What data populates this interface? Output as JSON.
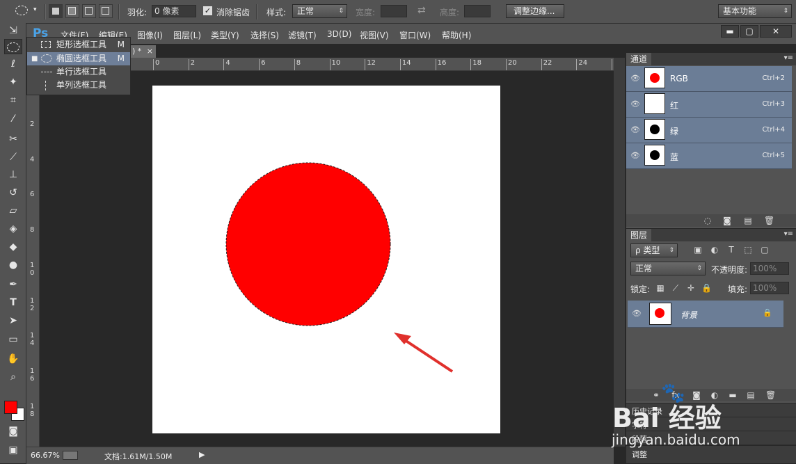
{
  "options_bar": {
    "feather_label": "羽化:",
    "feather_value": "0 像素",
    "antialias_label": "消除锯齿",
    "style_label": "样式:",
    "style_value": "正常",
    "width_label": "宽度:",
    "height_label": "高度:",
    "refine_edge_button": "调整边缘...",
    "workspace_value": "基本功能"
  },
  "menu_bar": {
    "logo": "Ps",
    "items": [
      "文件(F)",
      "编辑(E)",
      "图像(I)",
      "图层(L)",
      "类型(Y)",
      "选择(S)",
      "滤镜(T)",
      "3D(D)",
      "视图(V)",
      "窗口(W)",
      "帮助(H)"
    ]
  },
  "tool_flyout": {
    "items": [
      {
        "label": "矩形选框工具",
        "key": "M",
        "selected": false
      },
      {
        "label": "椭圆选框工具",
        "key": "M",
        "selected": true
      },
      {
        "label": "单行选框工具",
        "key": "",
        "selected": false
      },
      {
        "label": "单列选框工具",
        "key": "",
        "selected": false
      }
    ]
  },
  "document": {
    "tab_label": ") *",
    "close": "×",
    "shape_color": "#ff0000",
    "ruler_h": [
      "0",
      "2",
      "4",
      "6",
      "8",
      "10",
      "12",
      "14",
      "16",
      "18",
      "20",
      "22",
      "24",
      "2"
    ],
    "ruler_v": [
      "2",
      "4",
      "6",
      "8",
      "1\n0",
      "1\n2",
      "1\n4",
      "1\n6",
      "1\n8"
    ]
  },
  "status_bar": {
    "zoom": "66.67%",
    "doc_info": "文档:1.61M/1.50M"
  },
  "channels_panel": {
    "tab": "通道",
    "rows": [
      {
        "name": "RGB",
        "shortcut": "Ctrl+2",
        "dot_color": "#ff0000"
      },
      {
        "name": "红",
        "shortcut": "Ctrl+3",
        "dot_color": ""
      },
      {
        "name": "绿",
        "shortcut": "Ctrl+4",
        "dot_color": "#000000"
      },
      {
        "name": "蓝",
        "shortcut": "Ctrl+5",
        "dot_color": "#000000"
      }
    ]
  },
  "layers_panel": {
    "tab": "图层",
    "filter_label": "ρ 类型",
    "blend_mode": "正常",
    "opacity_label": "不透明度:",
    "opacity_value": "100%",
    "lock_label": "锁定:",
    "fill_label": "填充:",
    "fill_value": "100%",
    "layer_name": "背景",
    "layer_dot_color": "#ff0000"
  },
  "collapsed_panels": [
    "历史记录",
    "字符",
    "段落",
    "调整"
  ],
  "watermark": {
    "brand": "Bai 经验",
    "url": "jingyan.baidu.com"
  },
  "colors": {
    "foreground": "#ff0000",
    "background": "#ffffff",
    "accent_row": "#6b7d96"
  }
}
